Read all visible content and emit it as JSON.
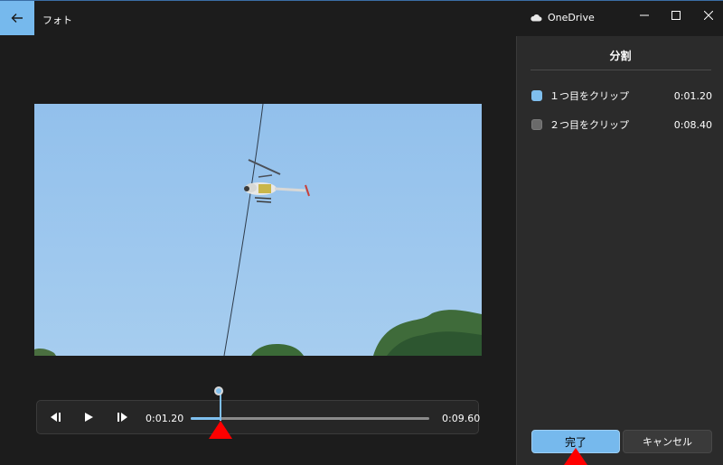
{
  "app": {
    "title": "フォト"
  },
  "cloud": {
    "label": "OneDrive"
  },
  "window_controls": [
    "minimize",
    "maximize",
    "close"
  ],
  "panel": {
    "title": "分割",
    "clips": [
      {
        "label": "１つ目をクリップ",
        "time": "0:01.20",
        "checked": true
      },
      {
        "label": "２つ目をクリップ",
        "time": "0:08.40",
        "checked": false
      }
    ],
    "done_label": "完了",
    "cancel_label": "キャンセル"
  },
  "player": {
    "current_time": "0:01.20",
    "total_time": "0:09.60",
    "progress_fraction": 0.125
  },
  "colors": {
    "accent": "#76b9ed",
    "marker": "#ff0000",
    "background": "#1c1c1c",
    "panel": "#2b2b2b"
  }
}
